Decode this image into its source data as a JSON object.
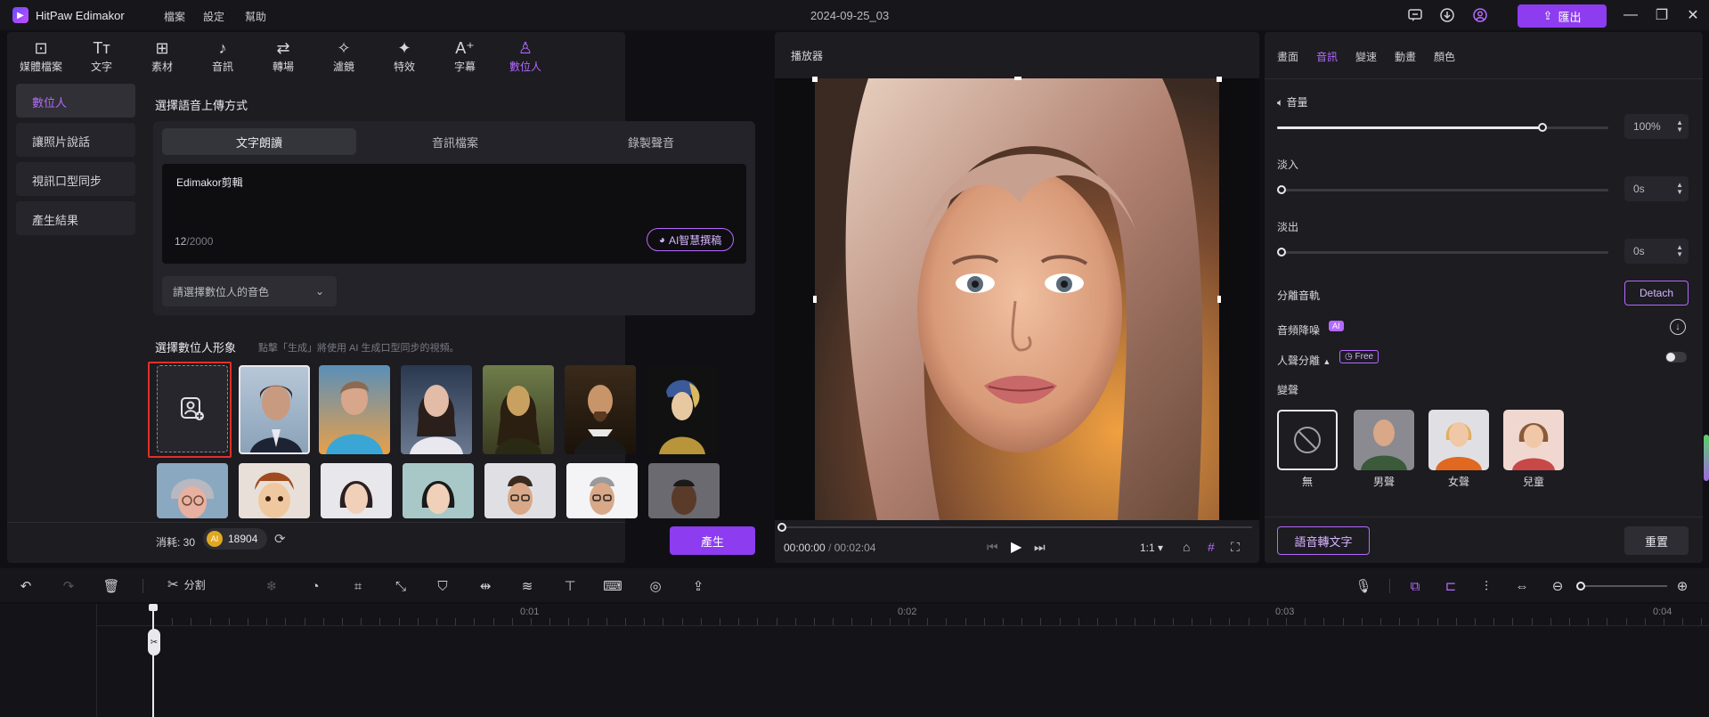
{
  "app": {
    "name": "HitPaw Edimakor",
    "project_title": "2024-09-25_03",
    "export_label": "匯出"
  },
  "menu": [
    "檔案",
    "設定",
    "幫助"
  ],
  "toolbar_tools": [
    {
      "label": "媒體檔案",
      "icon": "media-icon"
    },
    {
      "label": "文字",
      "icon": "text-icon"
    },
    {
      "label": "素材",
      "icon": "elements-icon"
    },
    {
      "label": "音訊",
      "icon": "audio-icon"
    },
    {
      "label": "轉場",
      "icon": "transition-icon"
    },
    {
      "label": "濾鏡",
      "icon": "filter-icon"
    },
    {
      "label": "特效",
      "icon": "effects-icon"
    },
    {
      "label": "字幕",
      "icon": "subtitle-icon"
    },
    {
      "label": "數位人",
      "icon": "digital-human-icon"
    }
  ],
  "sidebar": [
    "數位人",
    "讓照片說話",
    "視訊口型同步",
    "產生結果"
  ],
  "voice_section": {
    "title": "選擇語音上傳方式",
    "tabs": [
      "文字朗讀",
      "音訊檔案",
      "錄製聲音"
    ],
    "text_value": "Edimakor剪輯",
    "char_count": "12",
    "char_limit": "/2000",
    "ai_button": "AI智慧撰稿",
    "voice_placeholder": "請選擇數位人的音色"
  },
  "avatar_section": {
    "title": "選擇數位人形象",
    "hint": "點擊「生成」將使用 AI 生成口型同步的視頻。"
  },
  "generate_bar": {
    "cost_label": "消耗: 30",
    "credits": "18904",
    "generate_label": "產生"
  },
  "player": {
    "title": "播放器",
    "current_time": "00:00:00",
    "separator": "/",
    "total_time": "00:02:04",
    "ratio": "1:1"
  },
  "right_panel": {
    "tabs": [
      "畫面",
      "音訊",
      "變速",
      "動畫",
      "顏色"
    ],
    "volume_label": "音量",
    "volume_value": "100%",
    "volume_level": 0.8,
    "fade_in_label": "淡入",
    "fade_in_value": "0s",
    "fade_out_label": "淡出",
    "fade_out_value": "0s",
    "separate_audio_label": "分離音軌",
    "detach_label": "Detach",
    "denoise_label": "音頻降噪",
    "ai_badge": "AI",
    "vocal_sep_label": "人聲分離",
    "free_badge": "Free",
    "voice_change_label": "變聲",
    "voice_options": [
      "無",
      "男聲",
      "女聲",
      "兒童"
    ],
    "speech_to_text": "語音轉文字",
    "reset": "重置"
  },
  "timeline_toolbar": {
    "split_label": "分割"
  },
  "ruler": [
    "0:01",
    "0:02",
    "0:03",
    "0:04"
  ],
  "colors": {
    "accent": "#8d3cf0",
    "accent_text": "#b569ff",
    "panel": "#1c1c21"
  }
}
